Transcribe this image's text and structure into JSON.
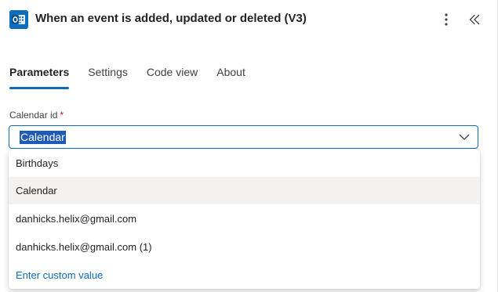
{
  "header": {
    "title": "When an event is added, updated or deleted (V3)",
    "icon": "outlook-calendar-icon",
    "accent": "#0f6cbd"
  },
  "tabs": [
    {
      "label": "Parameters",
      "active": true
    },
    {
      "label": "Settings",
      "active": false
    },
    {
      "label": "Code view",
      "active": false
    },
    {
      "label": "About",
      "active": false
    }
  ],
  "calendar_field": {
    "label": "Calendar id",
    "required_mark": "*",
    "value": "Calendar"
  },
  "dropdown": {
    "options": [
      {
        "label": "Birthdays",
        "selected": false
      },
      {
        "label": "Calendar",
        "selected": true
      },
      {
        "label": "danhicks.helix@gmail.com",
        "selected": false
      },
      {
        "label": "danhicks.helix@gmail.com (1)",
        "selected": false
      }
    ],
    "custom_value_label": "Enter custom value"
  }
}
